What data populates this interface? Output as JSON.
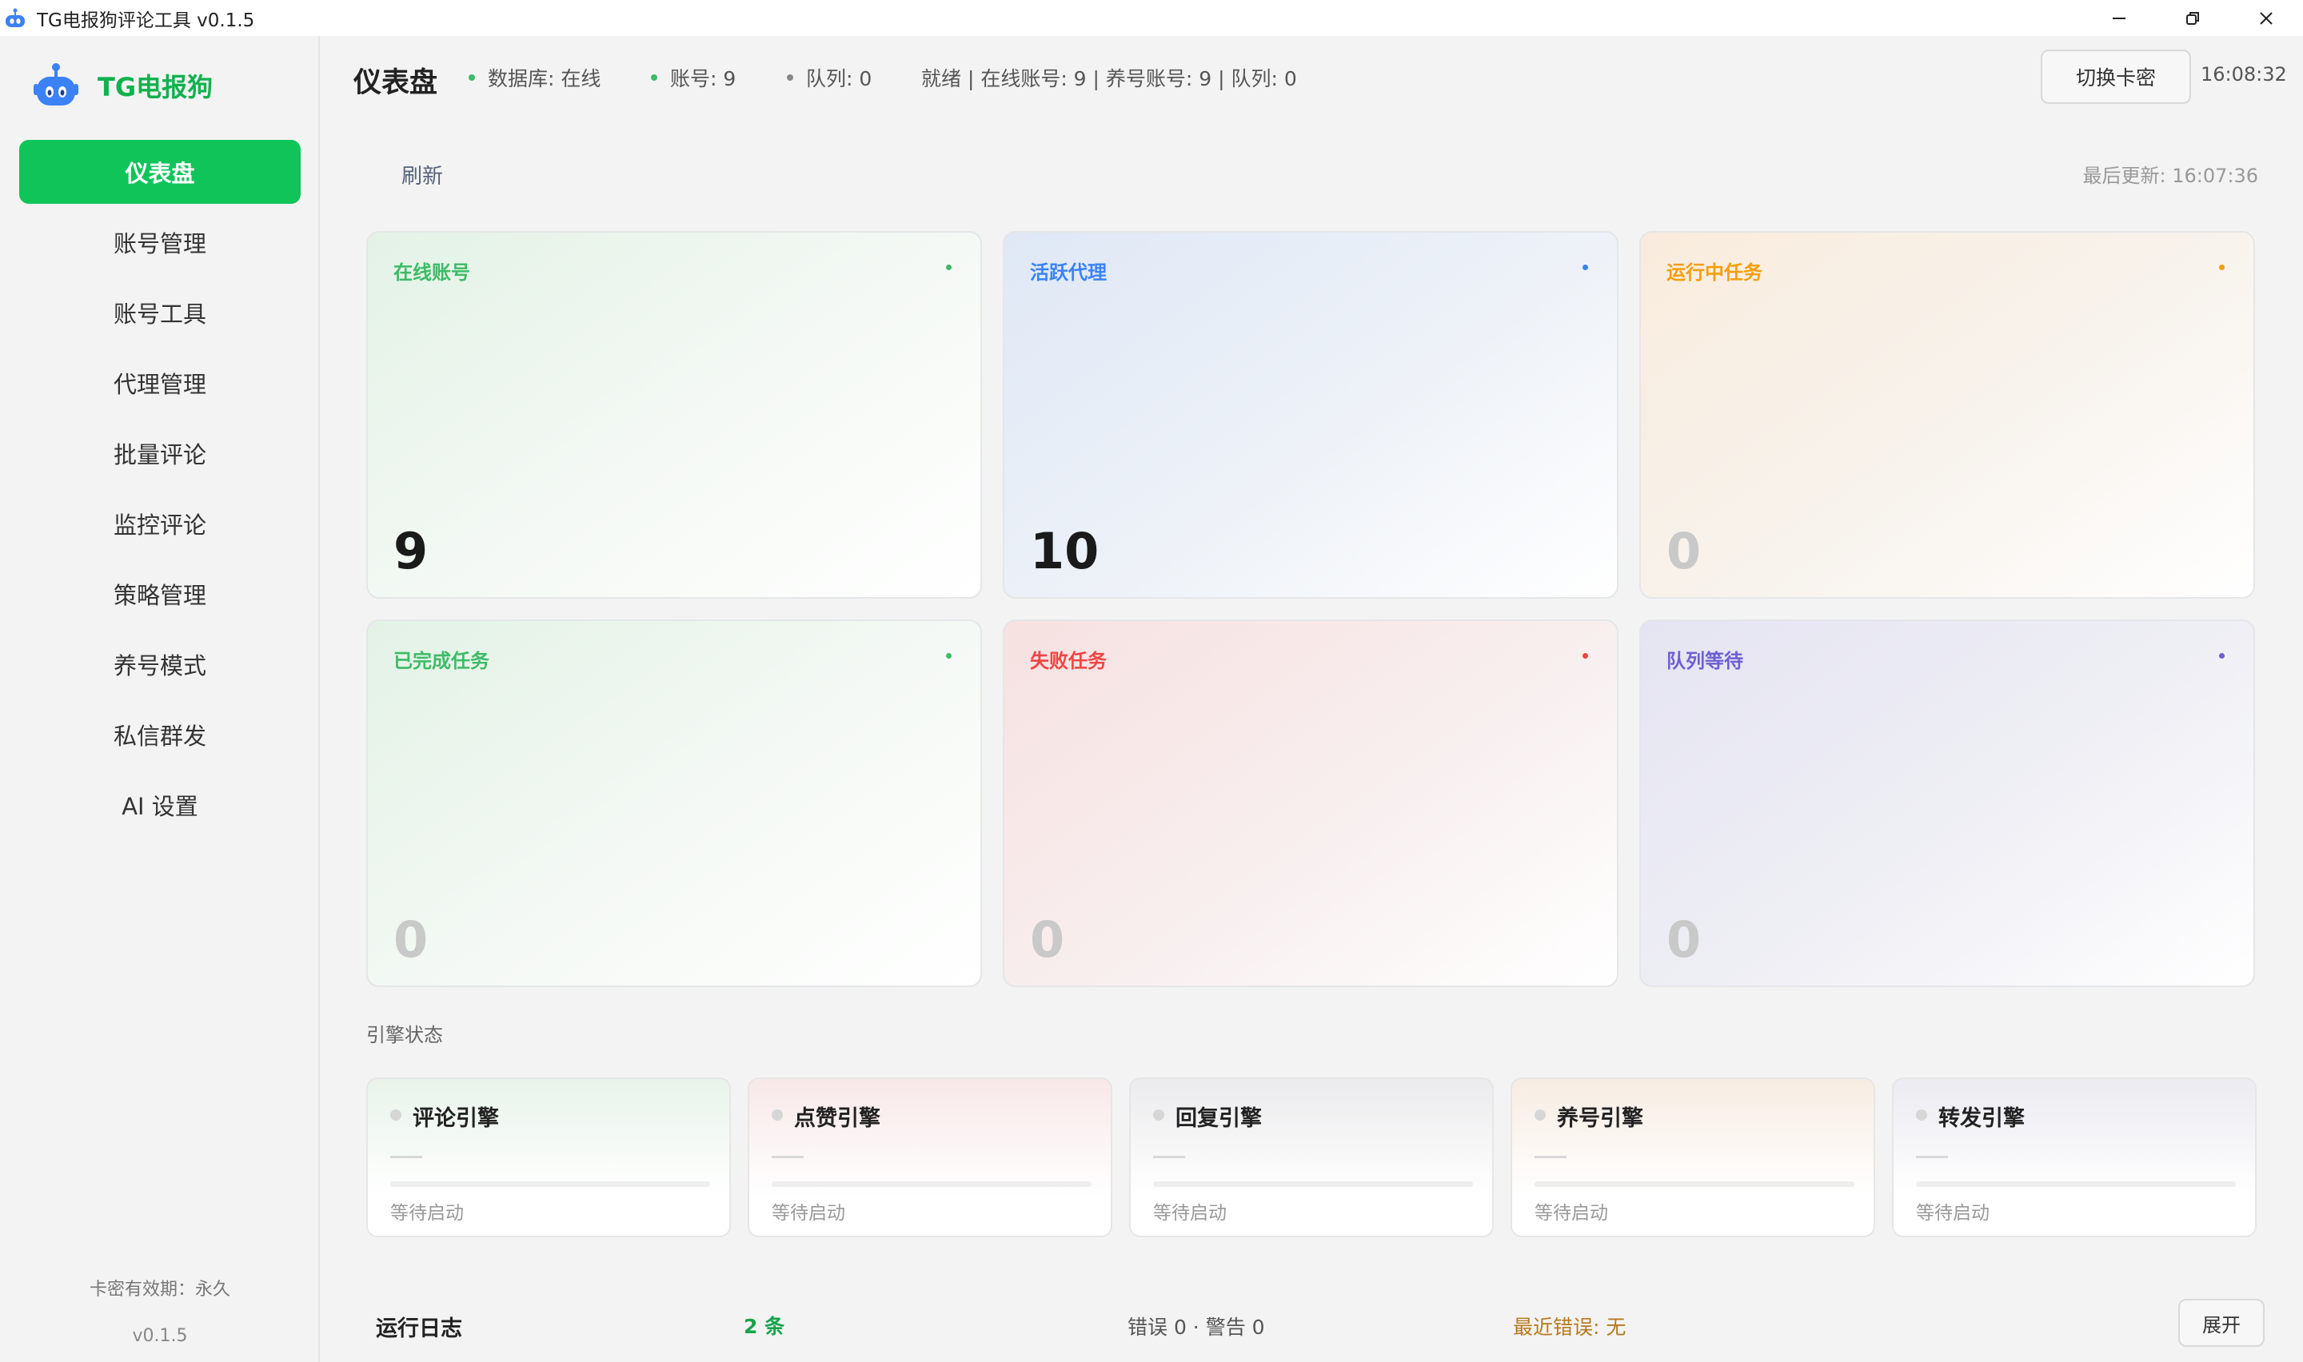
{
  "window": {
    "title": "TG电报狗评论工具 v0.1.5"
  },
  "sidebar": {
    "brand": "TG电报狗",
    "items": [
      {
        "label": "仪表盘",
        "active": true
      },
      {
        "label": "账号管理"
      },
      {
        "label": "账号工具"
      },
      {
        "label": "代理管理"
      },
      {
        "label": "批量评论"
      },
      {
        "label": "监控评论"
      },
      {
        "label": "策略管理"
      },
      {
        "label": "养号模式"
      },
      {
        "label": "私信群发"
      },
      {
        "label": "AI 设置"
      }
    ],
    "license": "卡密有效期：永久",
    "version": "v0.1.5"
  },
  "header": {
    "title": "仪表盘",
    "db_status": "数据库: 在线",
    "accounts": "账号: 9",
    "queue": "队列: 0",
    "summary": "就绪 | 在线账号: 9 | 养号账号: 9 | 队列: 0",
    "switch_label": "切换卡密",
    "time": "16:08:32"
  },
  "toolbar": {
    "refresh_label": "刷新",
    "last_update": "最后更新: 16:07:36"
  },
  "stats": [
    {
      "label": "在线账号",
      "value": "9",
      "color": "#3dbb66"
    },
    {
      "label": "活跃代理",
      "value": "10",
      "color": "#3b82f6"
    },
    {
      "label": "运行中任务",
      "value": "0",
      "color": "#f59e0b"
    },
    {
      "label": "已完成任务",
      "value": "0",
      "color": "#3dbb66"
    },
    {
      "label": "失败任务",
      "value": "0",
      "color": "#ef4444"
    },
    {
      "label": "队列等待",
      "value": "0",
      "color": "#6d5fd3"
    }
  ],
  "engines": {
    "title": "引擎状态",
    "items": [
      {
        "name": "评论引擎",
        "dash": "—",
        "status": "等待启动"
      },
      {
        "name": "点赞引擎",
        "dash": "—",
        "status": "等待启动"
      },
      {
        "name": "回复引擎",
        "dash": "—",
        "status": "等待启动"
      },
      {
        "name": "养号引擎",
        "dash": "—",
        "status": "等待启动"
      },
      {
        "name": "转发引擎",
        "dash": "—",
        "status": "等待启动"
      }
    ]
  },
  "log": {
    "title": "运行日志",
    "count": "2 条",
    "errors": "错误 0 · 警告 0",
    "last_error": "最近错误: 无",
    "expand_label": "展开"
  }
}
